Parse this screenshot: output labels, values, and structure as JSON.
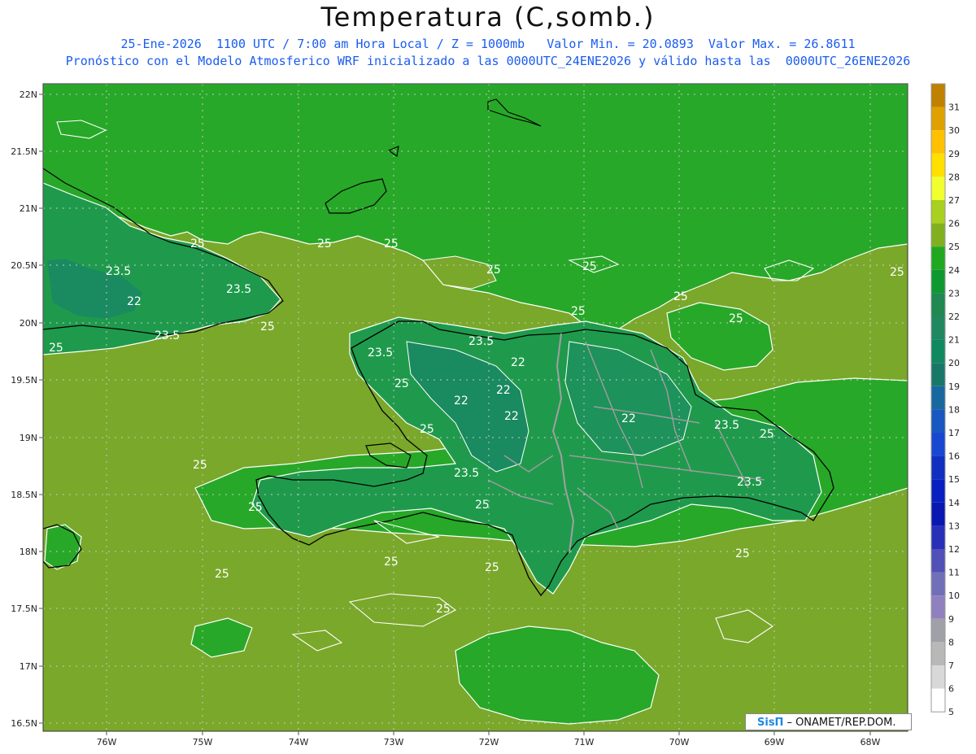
{
  "header": {
    "title": "Temperatura (C,somb.)",
    "subtitle_line1": "25-Ene-2026  1100 UTC / 7:00 am Hora Local / Z = 1000mb   Valor Min. = 20.0893  Valor Max. = 26.8611",
    "subtitle_line2": "Pronóstico con el Modelo Atmosferico WRF inicializado a las 0000UTC_24ENE2026 y válido hasta las  0000UTC_26ENE2026"
  },
  "axes": {
    "lat_labels": [
      "22N",
      "21.5N",
      "21N",
      "20.5N",
      "20N",
      "19.5N",
      "19N",
      "18.5N",
      "18N",
      "17.5N",
      "17N",
      "16.5N"
    ],
    "lon_labels": [
      "76W",
      "75W",
      "74W",
      "73W",
      "72W",
      "71W",
      "70W",
      "69W",
      "68W"
    ]
  },
  "contour_labels": [
    "25",
    "25",
    "25",
    "25",
    "25",
    "25",
    "25",
    "25",
    "25",
    "25",
    "25",
    "23.5",
    "23.5",
    "23.5",
    "23.5",
    "23.5",
    "23.5",
    "23.5",
    "23.5",
    "22",
    "22",
    "22",
    "22",
    "22",
    "22",
    "25",
    "25",
    "25",
    "25",
    "25",
    "25",
    "25",
    "25",
    "25",
    "25",
    "25"
  ],
  "colorbar": {
    "labels": [
      "31",
      "30",
      "29",
      "28",
      "27",
      "26",
      "25",
      "24",
      "23",
      "22",
      "21",
      "20",
      "19",
      "18",
      "17",
      "16",
      "15",
      "14",
      "13",
      "12",
      "11",
      "10",
      "9",
      "8",
      "7",
      "6",
      "5"
    ],
    "colors": [
      "#c08000",
      "#e0a000",
      "#ffc000",
      "#ffe000",
      "#f0ff30",
      "#a8d020",
      "#80b020",
      "#20a820",
      "#109830",
      "#208850",
      "#208860",
      "#108860",
      "#187868",
      "#1868a0",
      "#1858c0",
      "#1848d0",
      "#1030c0",
      "#0820c0",
      "#0818b0",
      "#2830b8",
      "#5050b8",
      "#7070b8",
      "#9080c0",
      "#a0a0a8",
      "#b8b8b8",
      "#d8d8d8",
      "#ffffff"
    ]
  },
  "credit": {
    "brand": "SisΠ",
    "text": "– ONAMET/REP.DOM."
  },
  "colors": {
    "sea_base": "#7aa82a",
    "land_24": "#28a828",
    "land_23": "#1c9a48",
    "land_22": "#1a8a5e",
    "title_blue": "#1a5cf0"
  },
  "icons": {
    "map": "temperature-map"
  }
}
